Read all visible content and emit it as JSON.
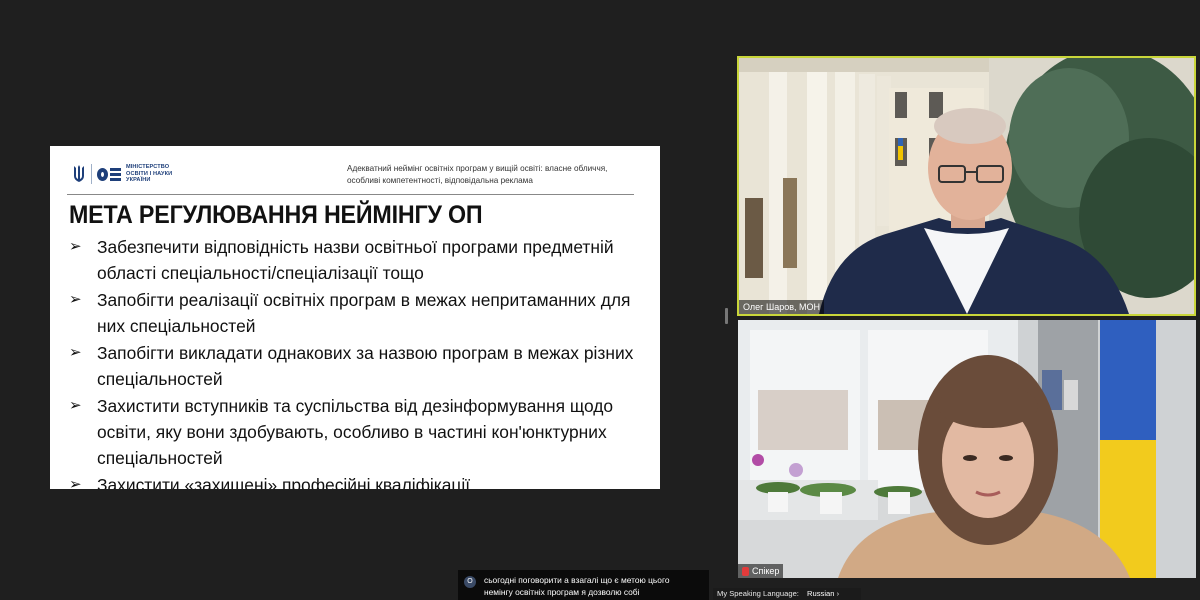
{
  "slide": {
    "ministry_lines": [
      "МІНІСТЕРСТВО",
      "ОСВІТИ І НАУКИ",
      "УКРАЇНИ"
    ],
    "subtitle_lines": [
      "Адекватний неймінг освітніх програм у вищій освіті: власне обличчя,",
      "особливі компетентності, відповідальна реклама"
    ],
    "title": "МЕТА РЕГУЛЮВАННЯ НЕЙМІНГУ ОП",
    "bullet_symbol": "➢",
    "bullets": [
      "Забезпечити відповідність назви освітньої програми предметній області спеціальності/спеціалізації тощо",
      "Запобігти реалізації освітніх програм в межах непритаманних для них спеціальностей",
      "Запобігти викладати однакових за назвою програм в межах різних спеціальностей",
      "Захистити вступників та суспільства від дезінформування щодо освіти, яку вони здобувають, особливо в частині кон'юнктурних спеціальностей",
      "Захистити «захищені» професійні кваліфікації"
    ]
  },
  "participants": [
    {
      "name": "Олег Шаров, МОН",
      "active_speaker": true
    },
    {
      "name": "Спікер",
      "muted": true
    }
  ],
  "caption": {
    "avatar_letter": "O",
    "lines": [
      "сьогодні поговорити  а  взагалі що є метою цього",
      "немінгу освітніх програм я дозволю собі"
    ]
  },
  "speaking_language": {
    "label": "My Speaking Language:",
    "value": "Russian",
    "chevron": "›"
  },
  "colors": {
    "active_speaker_border": "#c9d63a",
    "ministry_blue": "#1e3f7a",
    "background": "#1f1f1f"
  }
}
